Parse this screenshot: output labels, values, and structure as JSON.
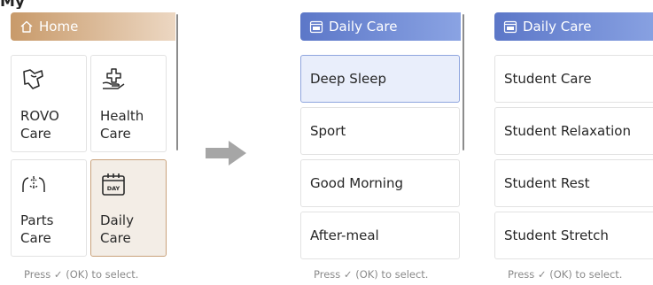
{
  "colors": {
    "home_header": "#c89a6a",
    "daily_header": "#5c77c8",
    "selected_tile_bg": "#f3ede6",
    "selected_list_bg": "#e9eefb",
    "arrow": "#a6a6a6"
  },
  "top_title_fragment": "My",
  "screen_home": {
    "header": {
      "icon": "home-icon",
      "title": "Home"
    },
    "tiles": [
      {
        "icon": "rovo-care-icon",
        "label": "ROVO\nCare",
        "selected": false
      },
      {
        "icon": "health-care-icon",
        "label": "Health\nCare",
        "selected": false
      },
      {
        "icon": "parts-care-icon",
        "label": "Parts\nCare",
        "selected": false
      },
      {
        "icon": "daily-calendar-icon",
        "label": "Daily\nCare",
        "selected": true
      }
    ],
    "footer": "Press ✓ (OK) to select."
  },
  "transition": {
    "icon": "right-arrow-icon"
  },
  "screen_daily_1": {
    "header": {
      "icon": "daily-calendar-icon",
      "title": "Daily Care"
    },
    "items": [
      {
        "label": "Deep Sleep",
        "selected": true
      },
      {
        "label": "Sport",
        "selected": false
      },
      {
        "label": "Good Morning",
        "selected": false
      },
      {
        "label": "After-meal",
        "selected": false
      }
    ],
    "footer": "Press ✓ (OK) to select."
  },
  "screen_daily_2": {
    "header": {
      "icon": "daily-calendar-icon",
      "title": "Daily Care"
    },
    "items": [
      {
        "label": "Student Care",
        "selected": false
      },
      {
        "label": "Student Relaxation",
        "selected": false
      },
      {
        "label": "Student Rest",
        "selected": false
      },
      {
        "label": "Student Stretch",
        "selected": false
      }
    ],
    "footer": "Press ✓ (OK) to select."
  }
}
